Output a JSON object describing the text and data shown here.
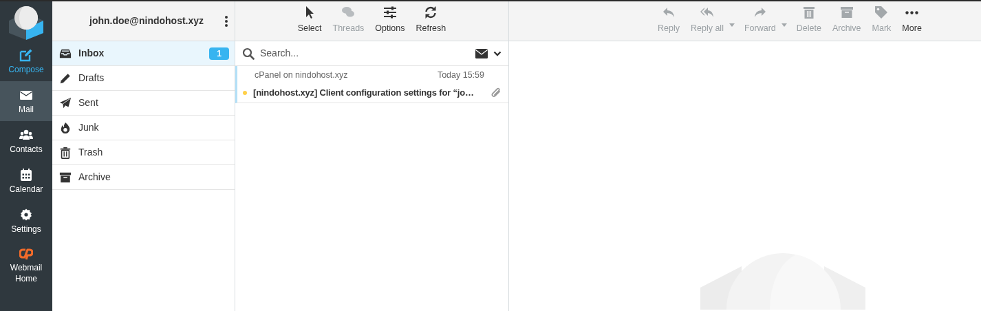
{
  "nav": [
    {
      "label": "Compose",
      "selected": false,
      "kind": "compose"
    },
    {
      "label": "Mail",
      "selected": true,
      "kind": "plain"
    },
    {
      "label": "Contacts",
      "selected": false,
      "kind": "plain"
    },
    {
      "label": "Calendar",
      "selected": false,
      "kind": "plain"
    },
    {
      "label": "Settings",
      "selected": false,
      "kind": "plain"
    },
    {
      "label": "Webmail Home",
      "selected": false,
      "kind": "cpanel"
    }
  ],
  "account": {
    "email": "john.doe@nindohost.xyz"
  },
  "folders": [
    {
      "label": "Inbox",
      "selected": true,
      "unread": "1"
    },
    {
      "label": "Drafts",
      "selected": false
    },
    {
      "label": "Sent",
      "selected": false
    },
    {
      "label": "Junk",
      "selected": false
    },
    {
      "label": "Trash",
      "selected": false
    },
    {
      "label": "Archive",
      "selected": false
    }
  ],
  "list_toolbar": [
    {
      "label": "Select",
      "disabled": false
    },
    {
      "label": "Threads",
      "disabled": true
    },
    {
      "label": "Options",
      "disabled": false
    },
    {
      "label": "Refresh",
      "disabled": false
    }
  ],
  "search": {
    "placeholder": "Search..."
  },
  "messages": [
    {
      "from": "cPanel on nindohost.xyz",
      "date": "Today 15:59",
      "subject": "[nindohost.xyz] Client configuration settings for “jo…",
      "unread": true,
      "attachment": true,
      "selected": true
    }
  ],
  "message_toolbar": [
    {
      "label": "Reply",
      "disabled": true,
      "has_menu": false
    },
    {
      "label": "Reply all",
      "disabled": true,
      "has_menu": true
    },
    {
      "label": "Forward",
      "disabled": true,
      "has_menu": true
    },
    {
      "label": "Delete",
      "disabled": true,
      "has_menu": false
    },
    {
      "label": "Archive",
      "disabled": true,
      "has_menu": false
    },
    {
      "label": "Mark",
      "disabled": true,
      "has_menu": false
    },
    {
      "label": "More",
      "disabled": false,
      "has_menu": false
    }
  ]
}
